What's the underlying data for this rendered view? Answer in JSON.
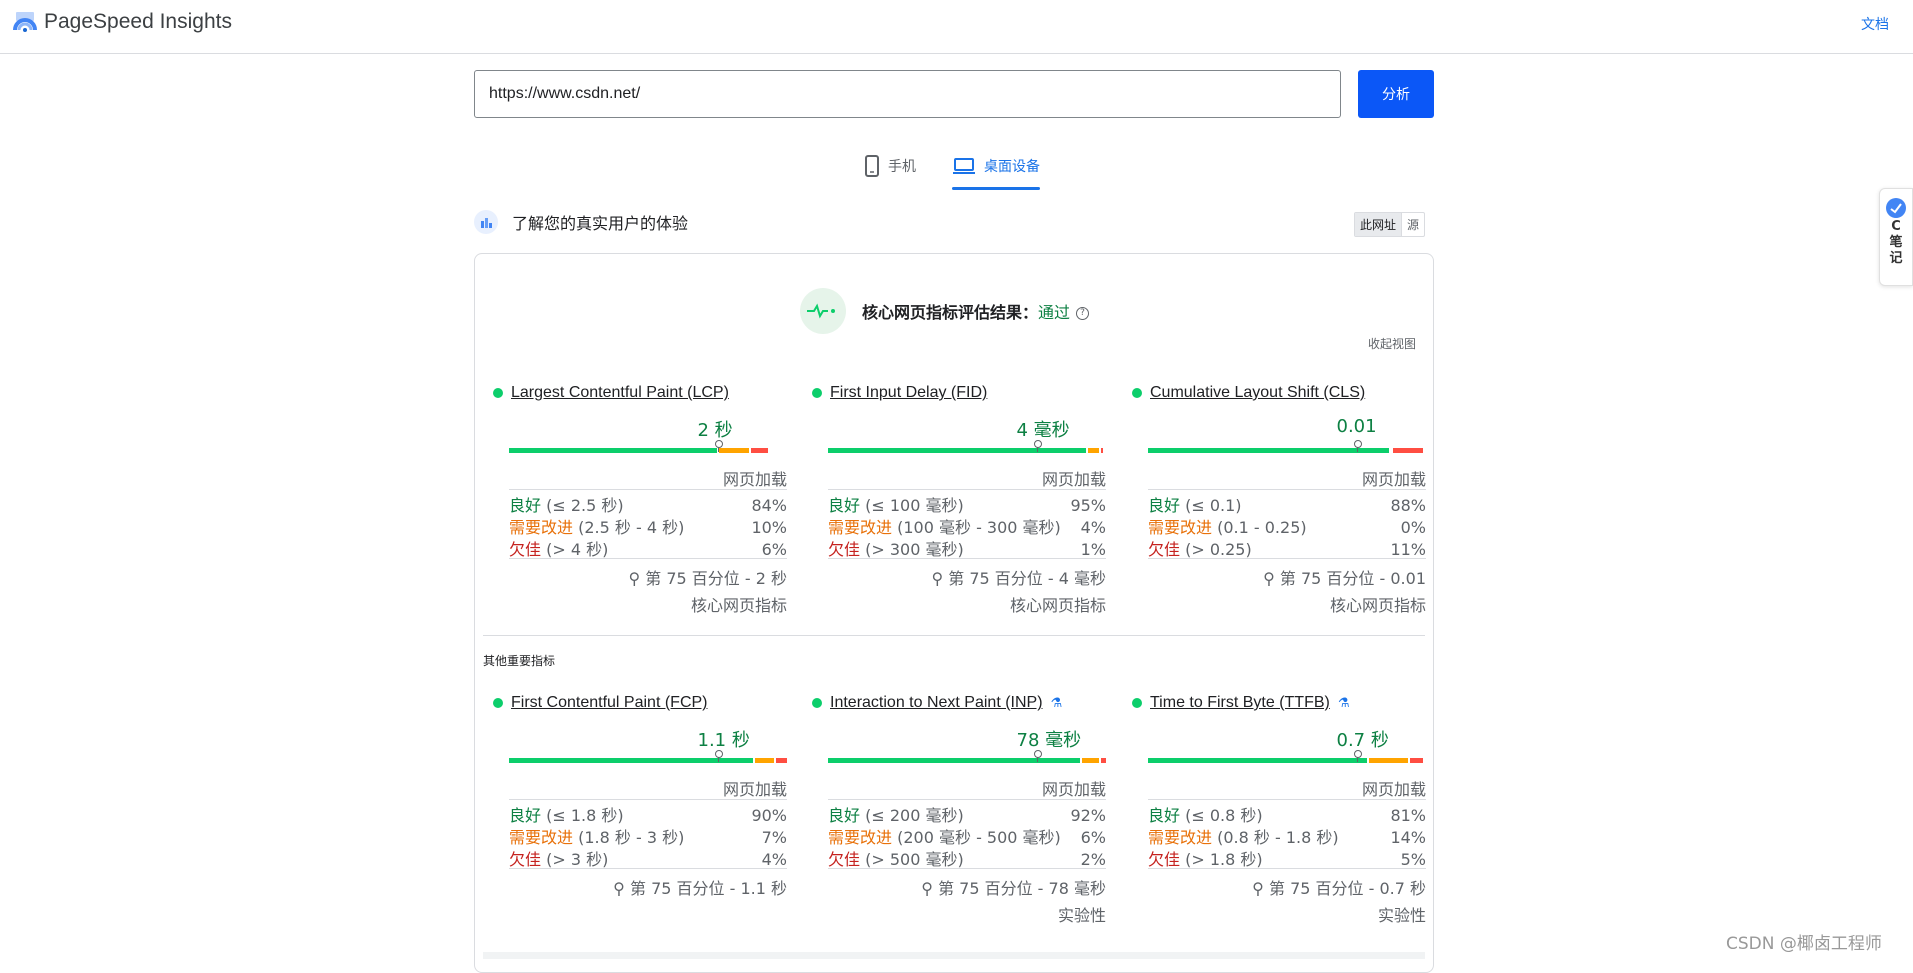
{
  "header": {
    "app_title": "PageSpeed Insights",
    "docs_label": "文档"
  },
  "search": {
    "url_value": "https://www.csdn.net/",
    "analyze_label": "分析"
  },
  "tabs": [
    {
      "label": "手机",
      "active": false
    },
    {
      "label": "桌面设备",
      "active": true
    }
  ],
  "crux": {
    "title": "了解您的真实用户的体验",
    "toggle": [
      "此网址",
      "源"
    ],
    "assessment_label": "核心网页指标评估结果：",
    "assessment_value": "通过",
    "collapse_label": "收起视图",
    "other_title": "其他重要指标"
  },
  "metrics": [
    {
      "name": "Largest Contentful Paint (LCP)",
      "value": "2 秒",
      "load": "网页加载",
      "bar": [
        0.76,
        0.11,
        0.06
      ],
      "pin": 0.75,
      "rows": [
        {
          "label": "良好",
          "range": "(≤ 2.5 秒)",
          "pct": "84%"
        },
        {
          "label": "需要改进",
          "range": "(2.5 秒 - 4 秒)",
          "pct": "10%"
        },
        {
          "label": "欠佳",
          "range": "(> 4 秒)",
          "pct": "6%"
        }
      ],
      "p75": "第 75 百分位 - 2 秒",
      "foot": "核心网页指标",
      "flask": false
    },
    {
      "name": "First Input Delay (FID)",
      "value": "4 毫秒",
      "load": "网页加载",
      "bar": [
        0.94,
        0.04,
        0.01
      ],
      "pin": 0.75,
      "rows": [
        {
          "label": "良好",
          "range": "(≤ 100 毫秒)",
          "pct": "95%"
        },
        {
          "label": "需要改进",
          "range": "(100 毫秒 - 300 毫秒)",
          "pct": "4%"
        },
        {
          "label": "欠佳",
          "range": "(> 300 毫秒)",
          "pct": "1%"
        }
      ],
      "p75": "第 75 百分位 - 4 毫秒",
      "foot": "核心网页指标",
      "flask": false
    },
    {
      "name": "Cumulative Layout Shift (CLS)",
      "value": "0.01",
      "load": "网页加载",
      "bar": [
        0.88,
        0.0,
        0.11
      ],
      "pin": 0.75,
      "rows": [
        {
          "label": "良好",
          "range": "(≤ 0.1)",
          "pct": "88%"
        },
        {
          "label": "需要改进",
          "range": "(0.1 - 0.25)",
          "pct": "0%"
        },
        {
          "label": "欠佳",
          "range": "(> 0.25)",
          "pct": "11%"
        }
      ],
      "p75": "第 75 百分位 - 0.01",
      "foot": "核心网页指标",
      "flask": false
    },
    {
      "name": "First Contentful Paint (FCP)",
      "value": "1.1 秒",
      "load": "网页加载",
      "bar": [
        0.89,
        0.07,
        0.04
      ],
      "pin": 0.75,
      "rows": [
        {
          "label": "良好",
          "range": "(≤ 1.8 秒)",
          "pct": "90%"
        },
        {
          "label": "需要改进",
          "range": "(1.8 秒 - 3 秒)",
          "pct": "7%"
        },
        {
          "label": "欠佳",
          "range": "(> 3 秒)",
          "pct": "4%"
        }
      ],
      "p75": "第 75 百分位 - 1.1 秒",
      "foot": "",
      "flask": false
    },
    {
      "name": "Interaction to Next Paint (INP)",
      "value": "78 毫秒",
      "load": "网页加载",
      "bar": [
        0.92,
        0.06,
        0.02
      ],
      "pin": 0.75,
      "rows": [
        {
          "label": "良好",
          "range": "(≤ 200 毫秒)",
          "pct": "92%"
        },
        {
          "label": "需要改进",
          "range": "(200 毫秒 - 500 毫秒)",
          "pct": "6%"
        },
        {
          "label": "欠佳",
          "range": "(> 500 毫秒)",
          "pct": "2%"
        }
      ],
      "p75": "第 75 百分位 - 78 毫秒",
      "foot": "实验性",
      "flask": true
    },
    {
      "name": "Time to First Byte (TTFB)",
      "value": "0.7 秒",
      "load": "网页加载",
      "bar": [
        0.8,
        0.14,
        0.05
      ],
      "pin": 0.75,
      "rows": [
        {
          "label": "良好",
          "range": "(≤ 0.8 秒)",
          "pct": "81%"
        },
        {
          "label": "需要改进",
          "range": "(0.8 秒 - 1.8 秒)",
          "pct": "14%"
        },
        {
          "label": "欠佳",
          "range": "(> 1.8 秒)",
          "pct": "5%"
        }
      ],
      "p75": "第 75 百分位 - 0.7 秒",
      "foot": "实验性",
      "flask": true
    }
  ],
  "side_widget": {
    "lines": [
      "C",
      "笔",
      "记"
    ]
  },
  "watermark": "CSDN @椰卤工程师",
  "colors": {
    "good": "#0cce6b",
    "average": "#ffa400",
    "poor": "#ff4e42",
    "accent": "#1a73e8"
  }
}
